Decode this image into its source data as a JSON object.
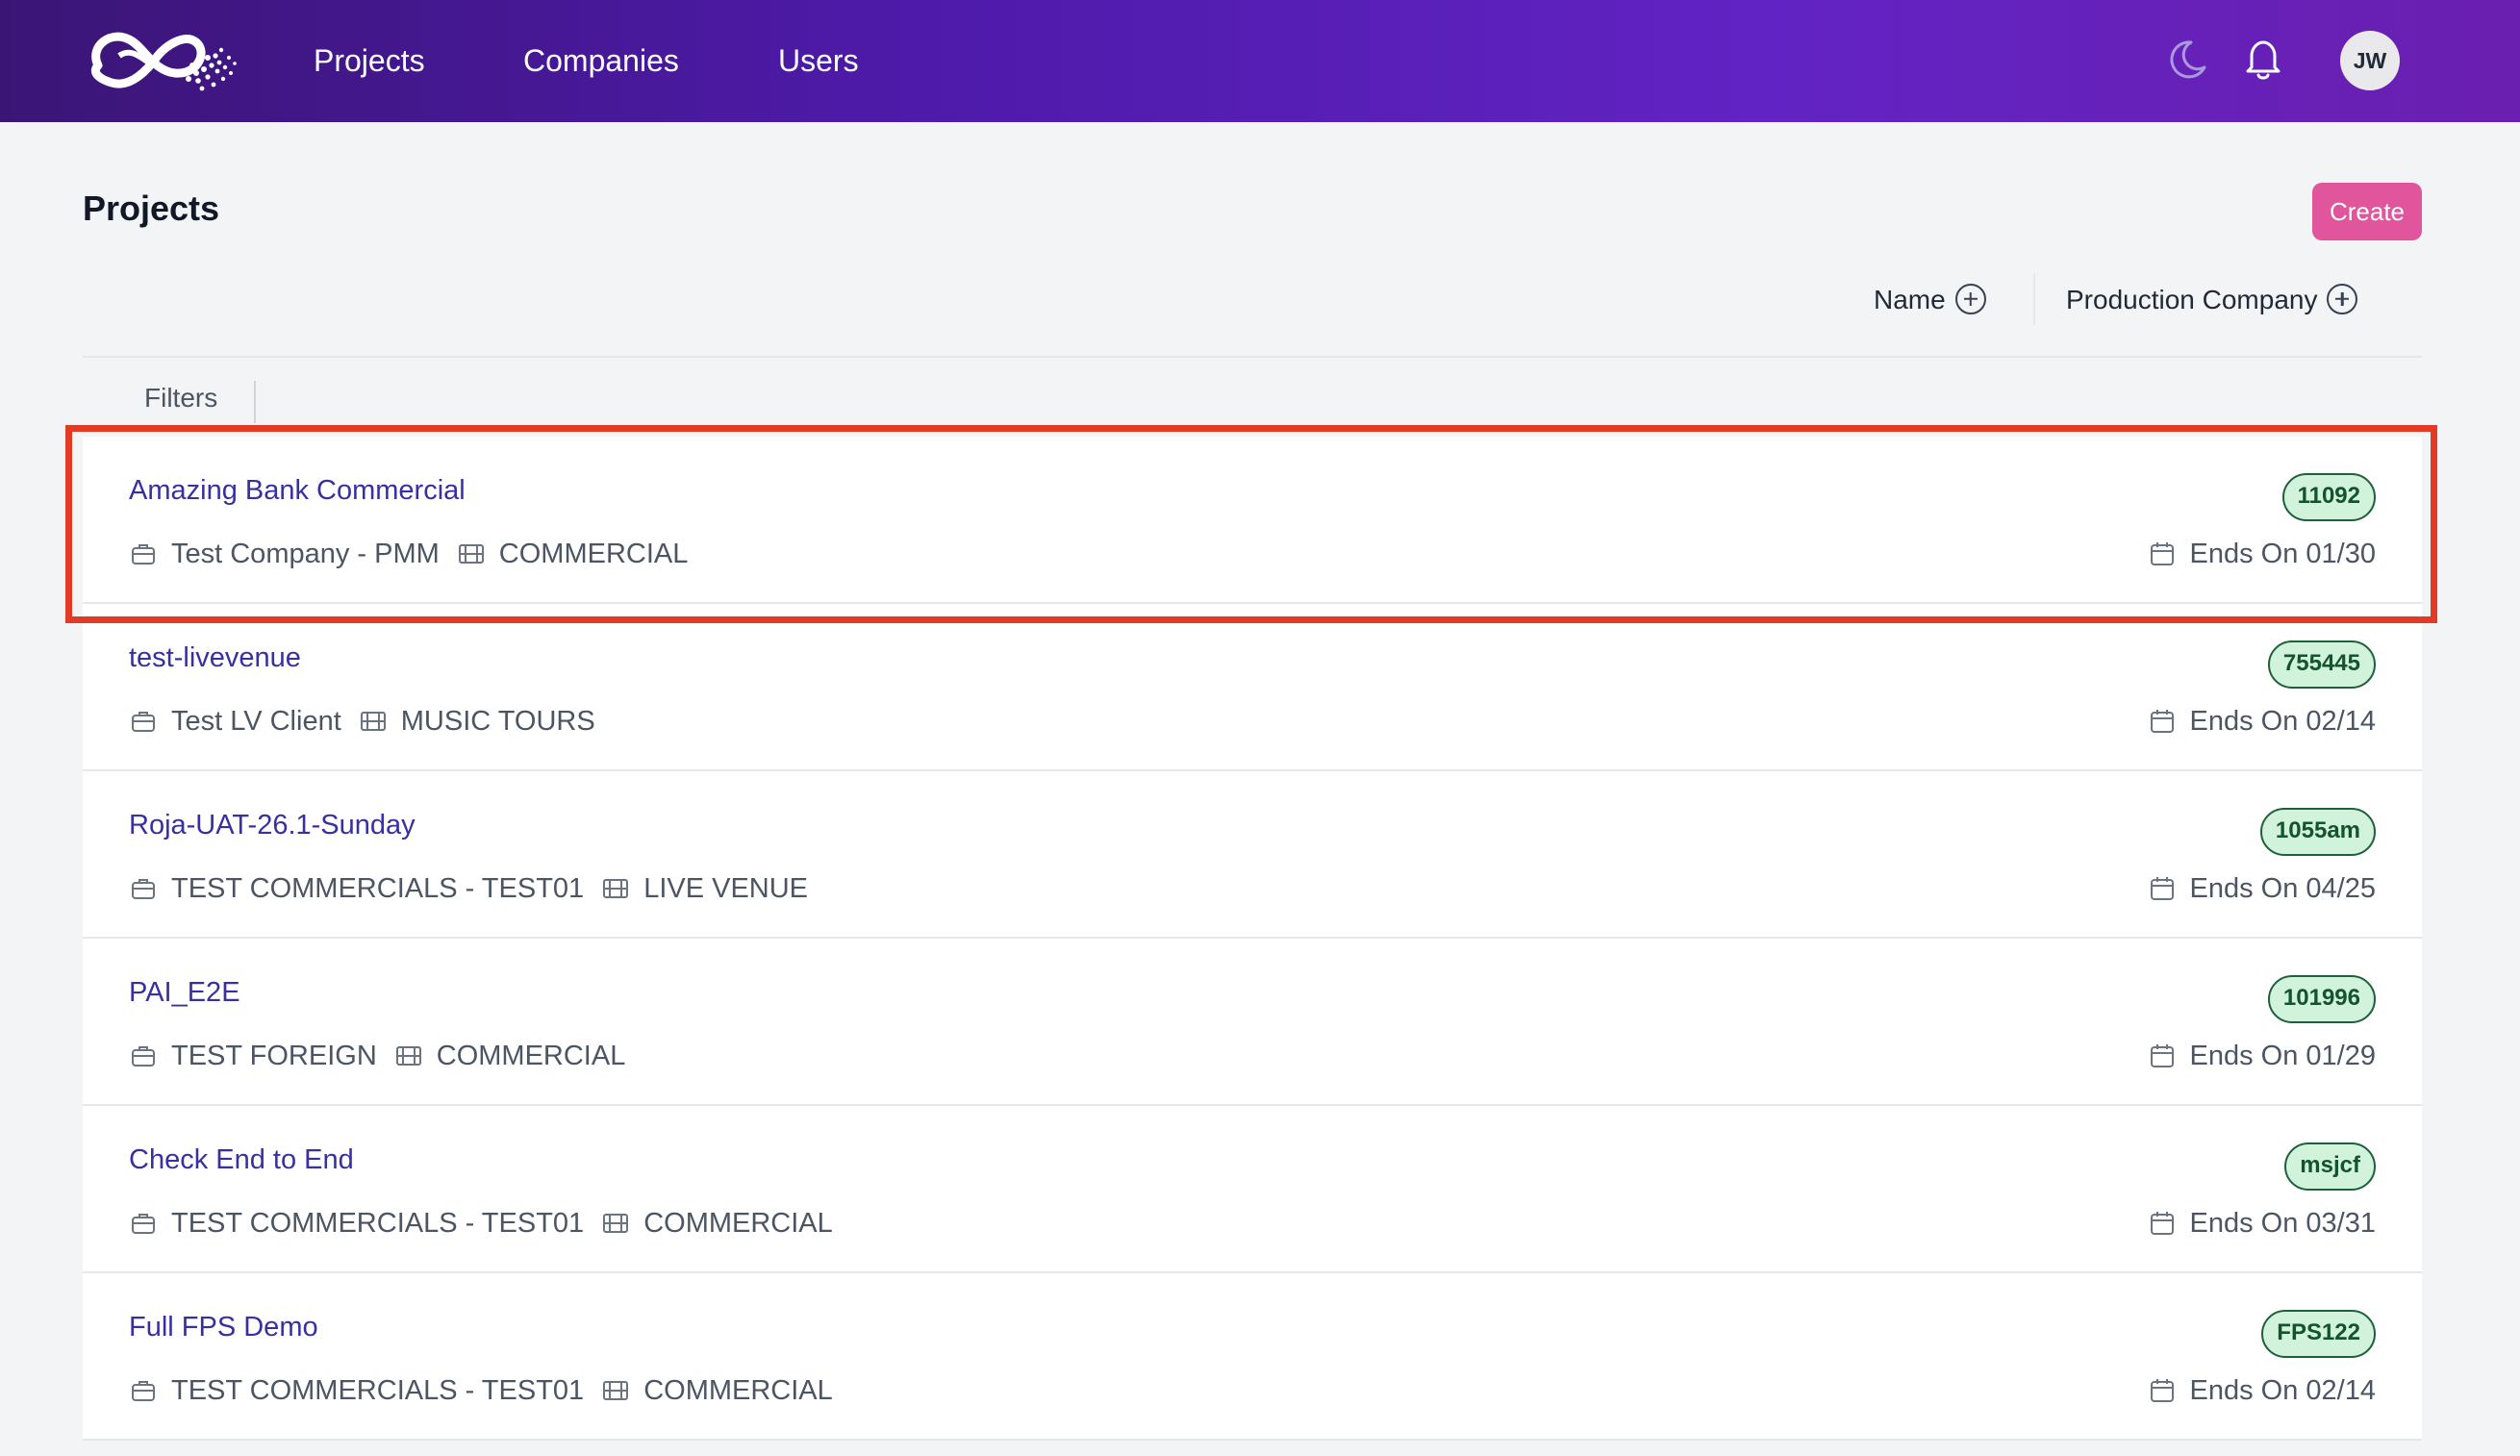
{
  "nav": {
    "items": [
      "Projects",
      "Companies",
      "Users"
    ],
    "avatar_initials": "JW",
    "icons": [
      "logo",
      "moon-icon",
      "bell-icon"
    ]
  },
  "page": {
    "title": "Projects",
    "create_label": "Create",
    "sort": {
      "name_label": "Name",
      "company_label": "Production Company"
    },
    "filters_label": "Filters"
  },
  "projects": [
    {
      "title": "Amazing Bank Commercial",
      "company": "Test Company - PMM",
      "type": "COMMERCIAL",
      "code": "11092",
      "ends": "Ends On 01/30"
    },
    {
      "title": "test-livevenue",
      "company": "Test LV Client",
      "type": "MUSIC TOURS",
      "code": "755445",
      "ends": "Ends On 02/14"
    },
    {
      "title": "Roja-UAT-26.1-Sunday",
      "company": "TEST COMMERCIALS - TEST01",
      "type": "LIVE VENUE",
      "code": "1055am",
      "ends": "Ends On 04/25"
    },
    {
      "title": "PAI_E2E",
      "company": "TEST FOREIGN",
      "type": "COMMERCIAL",
      "code": "101996",
      "ends": "Ends On 01/29"
    },
    {
      "title": "Check End to End",
      "company": "TEST COMMERCIALS - TEST01",
      "type": "COMMERCIAL",
      "code": "msjcf",
      "ends": "Ends On 03/31"
    },
    {
      "title": "Full FPS Demo",
      "company": "TEST COMMERCIALS - TEST01",
      "type": "COMMERCIAL",
      "code": "FPS122",
      "ends": "Ends On 02/14"
    }
  ],
  "colors": {
    "header_gradient_start": "#3b1576",
    "header_gradient_end": "#6a1fb0",
    "create_button": "#e0559b",
    "link": "#3730a3",
    "badge_bg": "#d1f3dc",
    "badge_border": "#1f5f3a",
    "highlight": "#e23a24"
  }
}
